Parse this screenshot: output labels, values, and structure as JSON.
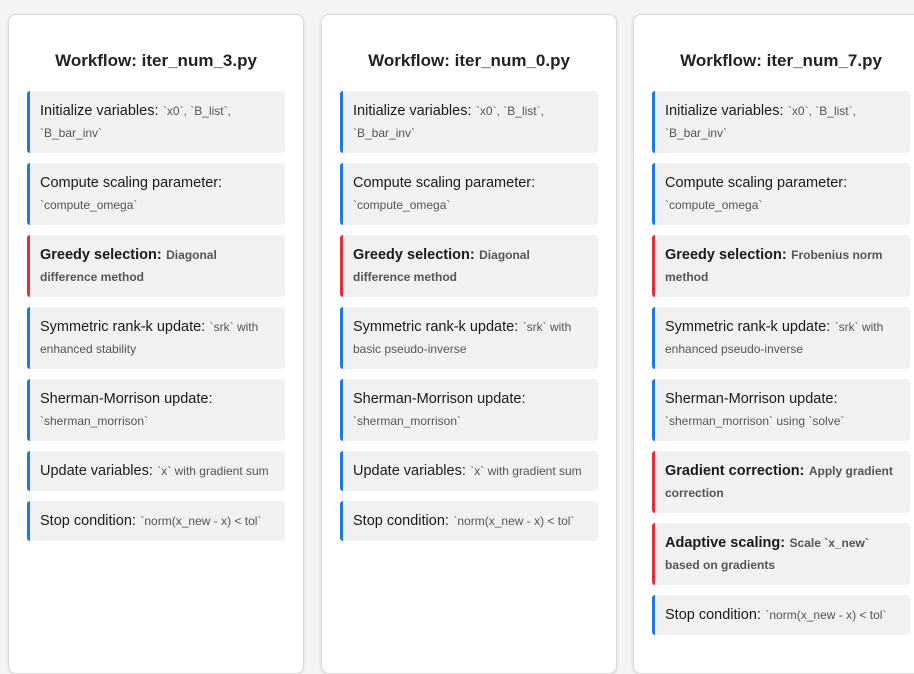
{
  "panels": [
    {
      "title": "Workflow: iter_num_3.py",
      "steps": [
        {
          "label": "Initialize variables:",
          "detail": "`x0`, `B_list`, `B_bar_inv`",
          "major": false
        },
        {
          "label": "Compute scaling parameter:",
          "detail": "`compute_omega`",
          "major": false
        },
        {
          "label": "Greedy selection:",
          "detail": "Diagonal difference method",
          "major": true
        },
        {
          "label": "Symmetric rank-k update:",
          "detail": "`srk` with enhanced stability",
          "major": false
        },
        {
          "label": "Sherman-Morrison update:",
          "detail": "`sherman_morrison`",
          "major": false
        },
        {
          "label": "Update variables:",
          "detail": "`x` with gradient sum",
          "major": false
        },
        {
          "label": "Stop condition:",
          "detail": "`norm(x_new - x) < tol`",
          "major": false
        }
      ]
    },
    {
      "title": "Workflow: iter_num_0.py",
      "steps": [
        {
          "label": "Initialize variables:",
          "detail": "`x0`, `B_list`, `B_bar_inv`",
          "major": false
        },
        {
          "label": "Compute scaling parameter:",
          "detail": "`compute_omega`",
          "major": false
        },
        {
          "label": "Greedy selection:",
          "detail": "Diagonal difference method",
          "major": true
        },
        {
          "label": "Symmetric rank-k update:",
          "detail": "`srk` with basic pseudo-inverse",
          "major": false
        },
        {
          "label": "Sherman-Morrison update:",
          "detail": "`sherman_morrison`",
          "major": false
        },
        {
          "label": "Update variables:",
          "detail": "`x` with gradient sum",
          "major": false
        },
        {
          "label": "Stop condition:",
          "detail": "`norm(x_new - x) < tol`",
          "major": false
        }
      ]
    },
    {
      "title": "Workflow: iter_num_7.py",
      "steps": [
        {
          "label": "Initialize variables:",
          "detail": "`x0`, `B_list`, `B_bar_inv`",
          "major": false
        },
        {
          "label": "Compute scaling parameter:",
          "detail": "`compute_omega`",
          "major": false
        },
        {
          "label": "Greedy selection:",
          "detail": "Frobenius norm method",
          "major": true
        },
        {
          "label": "Symmetric rank-k update:",
          "detail": "`srk` with enhanced pseudo-inverse",
          "major": false
        },
        {
          "label": "Sherman-Morrison update:",
          "detail": "`sherman_morrison` using `solve`",
          "major": false
        },
        {
          "label": "Gradient correction:",
          "detail": "Apply gradient correction",
          "major": true
        },
        {
          "label": "Adaptive scaling:",
          "detail": "Scale `x_new` based on gradients",
          "major": true
        },
        {
          "label": "Stop condition:",
          "detail": "`norm(x_new - x) < tol`",
          "major": false
        }
      ]
    }
  ]
}
